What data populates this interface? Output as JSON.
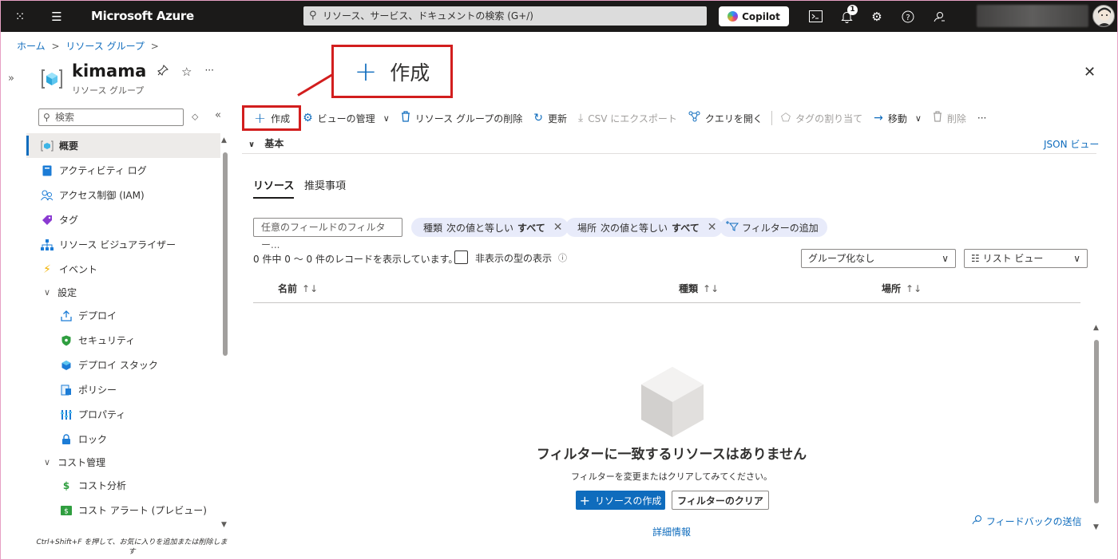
{
  "topbar": {
    "brand": "Microsoft Azure",
    "search_placeholder": "リソース、サービス、ドキュメントの検索 (G+/)",
    "copilot_label": "Copilot",
    "notification_count": "1"
  },
  "breadcrumb": [
    "ホーム",
    ">",
    "リソース グループ",
    ">"
  ],
  "resource": {
    "name": "kimama",
    "type": "リソース グループ"
  },
  "sidebar": {
    "search_placeholder": "検索",
    "items": [
      {
        "label": "概要",
        "icon": "resource-group-icon",
        "active": true
      },
      {
        "label": "アクティビティ ログ",
        "icon": "activity-log-icon"
      },
      {
        "label": "アクセス制御 (IAM)",
        "icon": "people-icon"
      },
      {
        "label": "タグ",
        "icon": "tag-icon"
      },
      {
        "label": "リソース ビジュアライザー",
        "icon": "visualizer-icon"
      },
      {
        "label": "イベント",
        "icon": "lightning-icon"
      }
    ],
    "groups": [
      {
        "label": "設定",
        "items": [
          {
            "label": "デプロイ",
            "icon": "deploy-icon"
          },
          {
            "label": "セキュリティ",
            "icon": "shield-icon"
          },
          {
            "label": "デプロイ スタック",
            "icon": "stack-icon"
          },
          {
            "label": "ポリシー",
            "icon": "policy-icon"
          },
          {
            "label": "プロパティ",
            "icon": "properties-icon"
          },
          {
            "label": "ロック",
            "icon": "lock-icon"
          }
        ]
      },
      {
        "label": "コスト管理",
        "items": [
          {
            "label": "コスト分析",
            "icon": "cost-analysis-icon"
          },
          {
            "label": "コスト アラート (プレビュー)",
            "icon": "cost-alert-icon"
          }
        ]
      }
    ],
    "shortcut_hint": "Ctrl+Shift+F を押して、お気に入りを追加または削除します"
  },
  "callout": {
    "label": "作成"
  },
  "toolbar": {
    "create": "作成",
    "manage_view": "ビューの管理",
    "delete_group": "リソース グループの削除",
    "refresh": "更新",
    "export_csv": "CSV にエクスポート",
    "open_query": "クエリを開く",
    "assign_tags": "タグの割り当て",
    "move": "移動",
    "delete": "削除",
    "more": "···"
  },
  "essentials": {
    "label": "基本",
    "json_view": "JSON ビュー"
  },
  "tabs": [
    "リソース",
    "推奨事項"
  ],
  "filters": {
    "field_placeholder": "任意のフィールドのフィルター...",
    "type_pill": {
      "name": "種類",
      "op": "次の値と等しい",
      "value": "すべて"
    },
    "location_pill": {
      "name": "場所",
      "op": "次の値と等しい",
      "value": "すべて"
    },
    "add_filter": "フィルターの追加"
  },
  "records": {
    "info": "0 件中 0 ～ 0 件のレコードを表示しています。",
    "show_hidden": "非表示の型の表示",
    "grouping": "グループ化なし",
    "view_mode": "☷ リスト ビュー"
  },
  "columns": [
    "名前",
    "種類",
    "場所"
  ],
  "empty_state": {
    "title": "フィルターに一致するリソースはありません",
    "subtitle": "フィルターを変更またはクリアしてみてください。",
    "create_button": "リソースの作成",
    "clear_button": "フィルターのクリア",
    "more_info": "詳細情報"
  },
  "feedback": "フィードバックの送信",
  "colors": {
    "accent": "#0f6cbd",
    "highlight": "#d21e1e",
    "topbar": "#1b1a19"
  }
}
